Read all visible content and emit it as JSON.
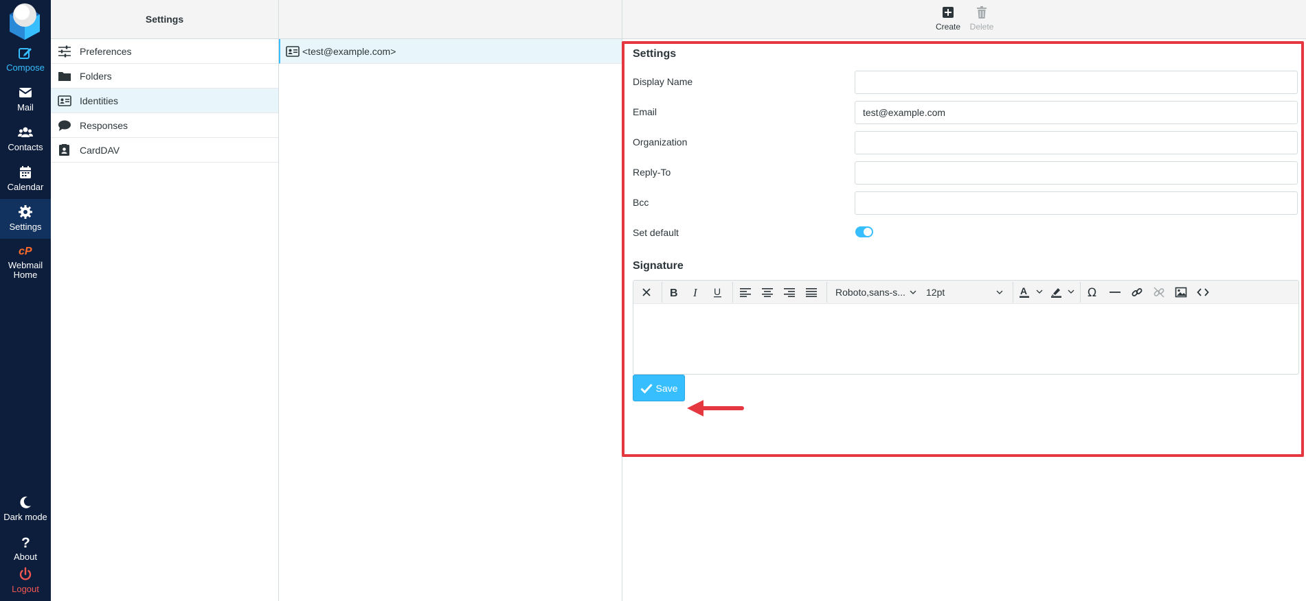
{
  "nav": {
    "compose": "Compose",
    "mail": "Mail",
    "contacts": "Contacts",
    "calendar": "Calendar",
    "settings": "Settings",
    "webmail_home_1": "Webmail",
    "webmail_home_2": "Home",
    "dark_mode": "Dark mode",
    "about": "About",
    "logout": "Logout"
  },
  "settings_column": {
    "title": "Settings",
    "items": [
      {
        "label": "Preferences",
        "icon": "sliders-icon"
      },
      {
        "label": "Folders",
        "icon": "folder-icon"
      },
      {
        "label": "Identities",
        "icon": "id-card-icon",
        "selected": true
      },
      {
        "label": "Responses",
        "icon": "comment-icon"
      },
      {
        "label": "CardDAV",
        "icon": "address-book-icon"
      }
    ]
  },
  "identities": {
    "items": [
      {
        "label": "<test@example.com>"
      }
    ]
  },
  "toolbar": {
    "create": "Create",
    "delete": "Delete"
  },
  "form": {
    "title": "Settings",
    "display_name_label": "Display Name",
    "display_name_value": "",
    "email_label": "Email",
    "email_value": "test@example.com",
    "organization_label": "Organization",
    "organization_value": "",
    "reply_to_label": "Reply-To",
    "reply_to_value": "",
    "bcc_label": "Bcc",
    "bcc_value": "",
    "set_default_label": "Set default",
    "set_default_on": true,
    "signature_title": "Signature",
    "font_family": "Roboto,sans-s...",
    "font_size": "12pt",
    "save_label": "Save"
  },
  "colors": {
    "nav_bg": "#0d1e3d",
    "accent": "#37beff",
    "highlight": "#e5373f",
    "logout": "#f25752",
    "cpanel": "#ff6c2c"
  }
}
